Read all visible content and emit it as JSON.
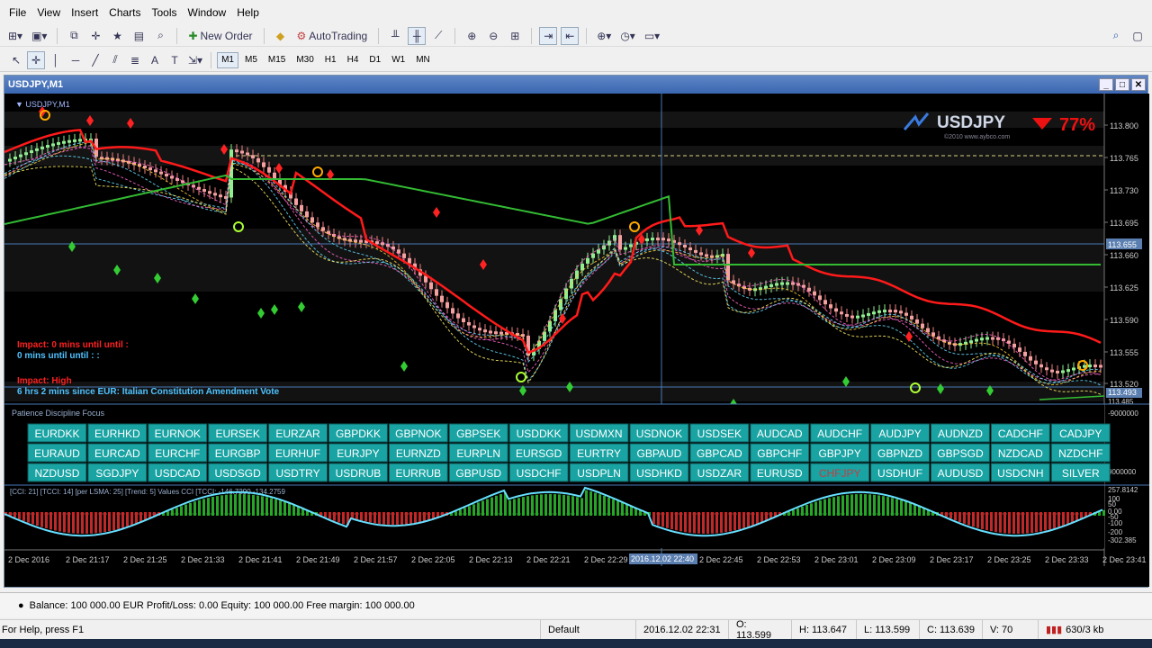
{
  "menu": [
    "File",
    "View",
    "Insert",
    "Charts",
    "Tools",
    "Window",
    "Help"
  ],
  "toolbar": {
    "new_order": "New Order",
    "autotrading": "AutoTrading"
  },
  "timeframes": [
    "M1",
    "M5",
    "M15",
    "M30",
    "H1",
    "H4",
    "D1",
    "W1",
    "MN"
  ],
  "active_timeframe": "M1",
  "window": {
    "title": "USDJPY,M1"
  },
  "chart": {
    "label": "USDJPY,M1",
    "symbol": "USDJPY",
    "percent": "77%",
    "copyright": "©2010 www.aybco.com",
    "price_ticks": [
      "113.800",
      "113.765",
      "113.730",
      "113.695",
      "113.660",
      "113.625",
      "113.590",
      "113.555",
      "113.520"
    ],
    "current_price": "113.655",
    "low_marker": "113.493",
    "low_marker2": "113.485",
    "impact_lines": [
      {
        "text": "Impact: 0 mins until until :",
        "color": "#ff2020"
      },
      {
        "text": "0 mins until until : :",
        "color": "#4fc3ff"
      },
      {
        "text": "Impact: High",
        "color": "#ff2020"
      },
      {
        "text": "6 hrs 2 mins since EUR: Italian Constitution Amendment Vote",
        "color": "#4fc3ff"
      }
    ],
    "panel_title": "Patience Discipline Focus",
    "panel_scale_top": "-9000000",
    "panel_scale_bottom": "9000000",
    "pairs": [
      [
        "EURDKK",
        "EURHKD",
        "EURNOK",
        "EURSEK",
        "EURZAR",
        "GBPDKK",
        "GBPNOK",
        "GBPSEK",
        "USDDKK",
        "USDMXN",
        "USDNOK",
        "USDSEK",
        "AUDCAD",
        "AUDCHF",
        "AUDJPY",
        "AUDNZD",
        "CADCHF",
        "CADJPY"
      ],
      [
        "EURAUD",
        "EURCAD",
        "EURCHF",
        "EURGBP",
        "EURHUF",
        "EURJPY",
        "EURNZD",
        "EURPLN",
        "EURSGD",
        "EURTRY",
        "GBPAUD",
        "GBPCAD",
        "GBPCHF",
        "GBPJPY",
        "GBPNZD",
        "GBPSGD",
        "NZDCAD",
        "NZDCHF"
      ],
      [
        "NZDUSD",
        "SGDJPY",
        "USDCAD",
        "USDSGD",
        "USDTRY",
        "USDRUB",
        "EURRUB",
        "GBPUSD",
        "USDCHF",
        "USDPLN",
        "USDHKD",
        "USDZAR",
        "EURUSD",
        "CHFJPY",
        "USDHUF",
        "AUDUSD",
        "USDCNH",
        "SILVER"
      ]
    ],
    "cci_label": "[CCI: 21] [TCCI: 14] [per LSMA: 25] [Trend: 5] Values CCI [TCCI: -146.7290 -134.2759",
    "cci_scale": [
      "257.8142",
      "100",
      "50",
      "0.00",
      "-50",
      "-100",
      "-200",
      "-302.385"
    ],
    "time_labels": [
      "2 Dec 2016",
      "2 Dec 21:17",
      "2 Dec 21:25",
      "2 Dec 21:33",
      "2 Dec 21:41",
      "2 Dec 21:49",
      "2 Dec 21:57",
      "2 Dec 22:05",
      "2 Dec 22:13",
      "2 Dec 22:21",
      "2 Dec 22:29",
      "2 Dec 22:45",
      "2 Dec 22:53",
      "2 Dec 23:01",
      "2 Dec 23:09",
      "2 Dec 23:17",
      "2 Dec 23:25",
      "2 Dec 23:33",
      "2 Dec 23:41"
    ],
    "cursor_time": "2016.12.02 22:40"
  },
  "account": {
    "text": "Balance: 100 000.00 EUR  Profit/Loss: 0.00  Equity: 100 000.00  Free margin: 100 000.00"
  },
  "status": {
    "help": "For Help, press F1",
    "profile": "Default",
    "datetime": "2016.12.02 22:31",
    "open": "O: 113.599",
    "high": "H: 113.647",
    "low": "L: 113.599",
    "close": "C: 113.639",
    "volume": "V: 70",
    "traffic": "630/3 kb"
  }
}
